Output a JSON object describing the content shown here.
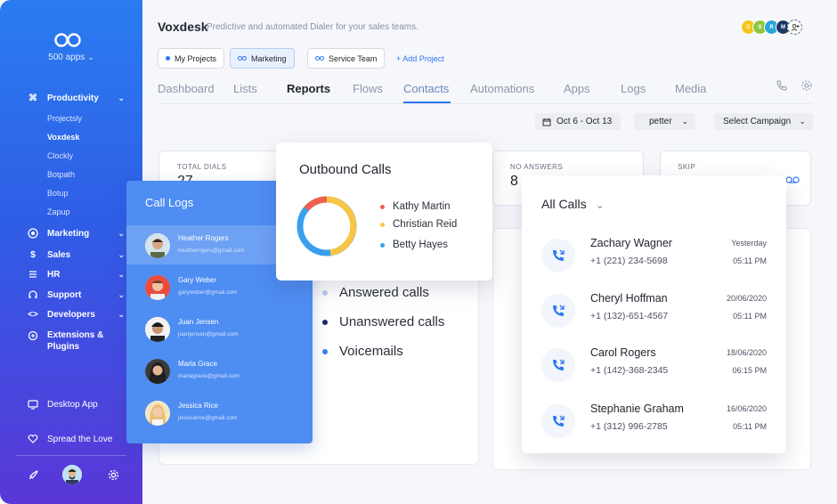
{
  "sidebar": {
    "apps_label": "500 apps",
    "nav": [
      {
        "label": "Productivity",
        "icon": "command-icon"
      },
      {
        "label": "Marketing",
        "icon": "target-icon"
      },
      {
        "label": "Sales",
        "icon": "dollar-icon"
      },
      {
        "label": "HR",
        "icon": "hr-icon"
      },
      {
        "label": "Support",
        "icon": "headset-icon"
      },
      {
        "label": "Developers",
        "icon": "code-icon"
      },
      {
        "label": "Extensions & Plugins",
        "icon": "puzzle-icon"
      }
    ],
    "sub_items": [
      "Projectsly",
      "Voxdesk",
      "Clockly",
      "Botpath",
      "Botup",
      "Zapup"
    ],
    "active_sub": "Voxdesk",
    "desktop_app": "Desktop App",
    "spread_love": "Spread the Love"
  },
  "header": {
    "title": "Voxdesk",
    "subtitle": "Predictive and automated Dialer for your sales teams.",
    "avatars": [
      "C",
      "S",
      "R",
      "M"
    ],
    "avatar_colors": [
      "#f5c518",
      "#8fc641",
      "#2aa6d9",
      "#1b3763"
    ]
  },
  "projects": {
    "chips": [
      "My Projects",
      "Marketing",
      "Service Team"
    ],
    "add_label": "+ Add Project"
  },
  "tabs": [
    "Dashboard",
    "Lists",
    "Reports",
    "Flows",
    "Contacts",
    "Automations",
    "Apps",
    "Logs",
    "Media"
  ],
  "filters": {
    "date_range": "Oct 6 - Oct 13",
    "agent": "petter",
    "campaign": "Select Campaign"
  },
  "stats": {
    "total_dials_label": "TOTAL DIALS",
    "total_dials_value": "27",
    "no_answers_label": "NO ANSWERS",
    "no_answers_value": "8",
    "skip_label": "SKIP"
  },
  "call_logs": {
    "title": "Call Logs",
    "rows": [
      {
        "name": "Heather Rogers",
        "email": "heatherrojers@gmail.com"
      },
      {
        "name": "Gary Weber",
        "email": "garyweber@gmail.com"
      },
      {
        "name": "Juan Jensen",
        "email": "juanjensen@gmail.com"
      },
      {
        "name": "Maria Grace",
        "email": "mariagrace@gmail.com"
      },
      {
        "name": "Jessica Rice",
        "email": "jessicarice@gmail.com"
      }
    ]
  },
  "call_legend": [
    {
      "label": "Answered calls",
      "color": "#b9cdf5"
    },
    {
      "label": "Unanswered calls",
      "color": "#1c2a66"
    },
    {
      "label": "Voicemails",
      "color": "#3b7df0"
    }
  ],
  "outbound": {
    "title": "Outbound Calls",
    "legend": [
      {
        "label": "Kathy Martin",
        "color": "#f0604d"
      },
      {
        "label": "Christian Reid",
        "color": "#f8c546"
      },
      {
        "label": "Betty Hayes",
        "color": "#3aa0ee"
      }
    ]
  },
  "all_calls": {
    "title": "All Calls",
    "rows": [
      {
        "name": "Zachary Wagner",
        "phone": "+1 (221) 234-5698",
        "date": "Yesterday",
        "time": "05:11 PM"
      },
      {
        "name": "Cheryl Hoffman",
        "phone": "+1 (132)-651-4567",
        "date": "20/06/2020",
        "time": "05:11 PM"
      },
      {
        "name": "Carol Rogers",
        "phone": "+1 (142)-368-2345",
        "date": "18/06/2020",
        "time": "06:15 PM"
      },
      {
        "name": "Stephanie Graham",
        "phone": "+1 (312) 996-2785",
        "date": "16/06/2020",
        "time": "05:11 PM"
      }
    ]
  }
}
